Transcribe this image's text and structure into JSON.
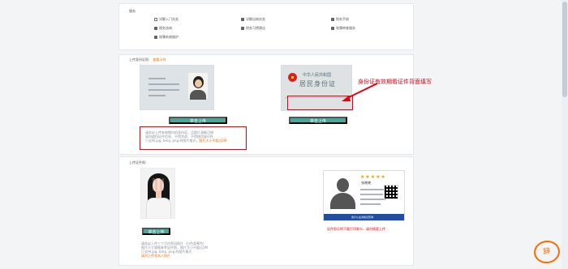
{
  "top": {
    "title": "服务",
    "items": [
      {
        "label": "详解入门实务",
        "checked": false
      },
      {
        "label": "详解出纳实务",
        "checked": true
      },
      {
        "label": "财务手册",
        "checked": true
      },
      {
        "label": "税务咨询",
        "checked": true
      },
      {
        "label": "财务习惯建议",
        "checked": true
      },
      {
        "label": "账簿审查服务",
        "checked": true
      },
      {
        "label": "账簿系统维护",
        "checked": true
      }
    ]
  },
  "id_section": {
    "title": "上传身份证照：",
    "sample_link": "查看示例",
    "front_button": "单击上传",
    "back_button": "单击上传",
    "annotation": "身份证有效期看证件背面填写",
    "tips": [
      "请务必上传有效期内的身份证，且图片清晰可辨",
      "请勿遮挡证件信息，不得涂改，不得使用复印件",
      "只支持 jpg, bmp, png 的图片格式，",
      "图片大小不超过2M"
    ]
  },
  "photo_section": {
    "title": "上传证件照：",
    "button": "单击上传",
    "caption": "证件照示例下载打印制卡，请勿随意上传",
    "tips": [
      "请务必上传三个月内免冠照片（白色背景色）",
      "图片尺寸规格参考证件照，图片大小不超过2M",
      "只支持 jpg, bmp, png 的图片格式",
      "请勿上传非本人照片"
    ]
  },
  "front_card": {
    "heading": "姓名",
    "name": "林小美"
  },
  "back_card": {
    "country": "中华人民共和国",
    "title": "居民身份证"
  },
  "profile_card": {
    "stars": "★★★★★",
    "name": "张晓晓",
    "bar_text": "会计从业资格证查询"
  },
  "watermark": "辞"
}
